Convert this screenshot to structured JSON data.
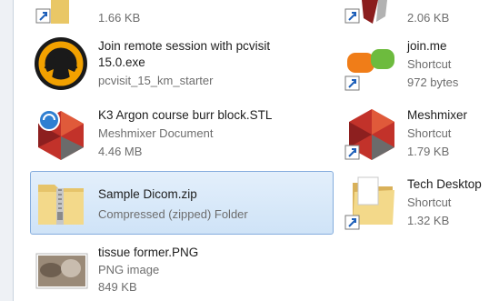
{
  "items": {
    "top_left_size": "1.66 KB",
    "top_right_size": "2.06 KB",
    "pcvisit": {
      "name_line1": "Join remote session with pcvisit",
      "name_line2": "15.0.exe",
      "meta": "pcvisit_15_km_starter"
    },
    "joinme": {
      "name": "join.me",
      "type": "Shortcut",
      "size": "972 bytes"
    },
    "k3": {
      "name": "K3 Argon course burr block.STL",
      "type": "Meshmixer Document",
      "size": "4.46 MB"
    },
    "meshmixer": {
      "name": "Meshmixer",
      "type": "Shortcut",
      "size": "1.79 KB"
    },
    "sample": {
      "name": "Sample Dicom.zip",
      "type": "Compressed (zipped) Folder"
    },
    "techdesktop": {
      "name": "Tech Desktop",
      "type": "Shortcut",
      "size": "1.32 KB"
    },
    "tissue": {
      "name": "tissue former.PNG",
      "type": "PNG image",
      "size": "849 KB"
    }
  },
  "colors": {
    "selection_fill": "#d6e8fb",
    "selection_border": "#84acdd",
    "pcvisit_ring": "#f2a100",
    "joinme_orange": "#f07d18",
    "joinme_green": "#6dbb3e",
    "mesh_red": "#c2322a"
  }
}
